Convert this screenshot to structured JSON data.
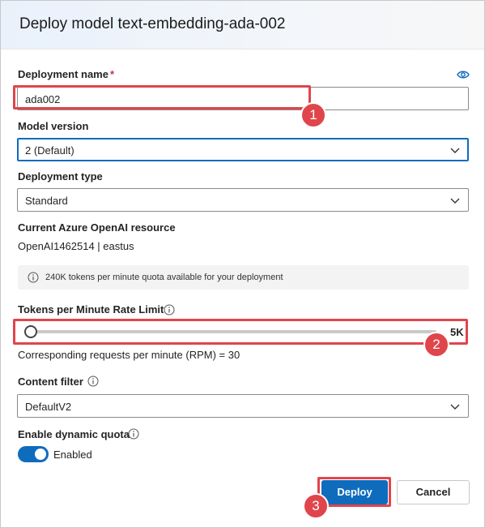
{
  "dialog": {
    "title": "Deploy model text-embedding-ada-002"
  },
  "deployment_name": {
    "label": "Deployment name",
    "required_marker": "*",
    "value": "ada002",
    "icon": "eye-icon"
  },
  "model_version": {
    "label": "Model version",
    "selected": "2 (Default)"
  },
  "deployment_type": {
    "label": "Deployment type",
    "selected": "Standard"
  },
  "resource": {
    "label": "Current Azure OpenAI resource",
    "value": "OpenAI1462514 | eastus"
  },
  "quota_banner": {
    "icon": "info-icon",
    "text": "240K tokens per minute quota available for your deployment"
  },
  "rate_limit": {
    "label": "Tokens per Minute Rate Limit",
    "value_label": "5K",
    "level_fraction": 0.0,
    "rpm_text": "Corresponding requests per minute (RPM) = 30"
  },
  "content_filter": {
    "label": "Content filter",
    "selected": "DefaultV2"
  },
  "dynamic_quota": {
    "label": "Enable dynamic quota",
    "state_label": "Enabled",
    "enabled": true
  },
  "buttons": {
    "deploy": "Deploy",
    "cancel": "Cancel"
  },
  "annotations": {
    "badge1": "1",
    "badge2": "2",
    "badge3": "3"
  },
  "colors": {
    "accent": "#0f6cbd",
    "highlight": "#e0454c",
    "required": "#c4314b"
  }
}
